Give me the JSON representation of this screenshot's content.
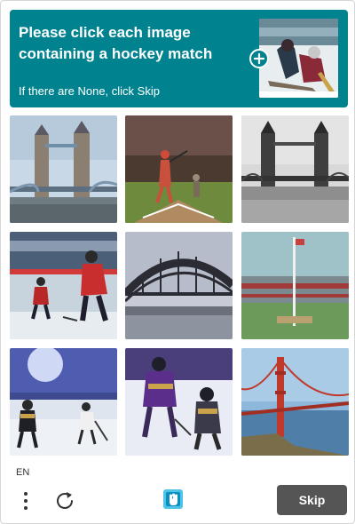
{
  "challenge": {
    "prompt": "Please click each image containing a hockey match",
    "hint": "If there are None, click Skip",
    "example_image": "hockey-match-example"
  },
  "grid": {
    "tiles": [
      {
        "subject": "tower-bridge-london"
      },
      {
        "subject": "baseball-batter-stadium"
      },
      {
        "subject": "tower-bridge-black-and-white"
      },
      {
        "subject": "hockey-players-red-jerseys"
      },
      {
        "subject": "steel-arch-bridge"
      },
      {
        "subject": "stadium-with-flag-pole"
      },
      {
        "subject": "hockey-players-arena"
      },
      {
        "subject": "hockey-players-purple-jerseys"
      },
      {
        "subject": "golden-gate-bridge"
      }
    ]
  },
  "footer": {
    "language": "EN",
    "skip_label": "Skip"
  },
  "colors": {
    "header": "#00838f",
    "skip_button": "#555555"
  }
}
